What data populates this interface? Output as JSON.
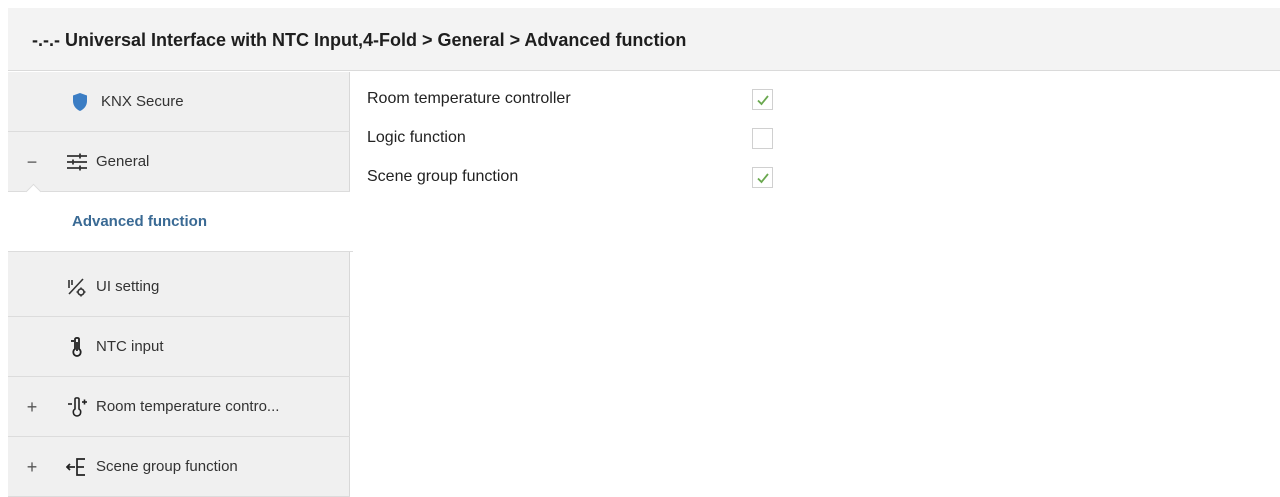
{
  "header": {
    "title": "-.-.- Universal Interface with NTC Input,4-Fold > General > Advanced function"
  },
  "sidebar": {
    "items": [
      {
        "label": "KNX Secure",
        "icon": "shield-icon",
        "expander": ""
      },
      {
        "label": "General",
        "icon": "sliders-icon",
        "expander": "−"
      },
      {
        "label": "Advanced function",
        "icon": "",
        "expander": ""
      },
      {
        "label": "UI setting",
        "icon": "ui-setting-icon",
        "expander": ""
      },
      {
        "label": "NTC input",
        "icon": "ntc-sensor-icon",
        "expander": ""
      },
      {
        "label": "Room temperature contro...",
        "icon": "thermometer-icon",
        "expander": "+"
      },
      {
        "label": "Scene group function",
        "icon": "scene-group-icon",
        "expander": "+"
      }
    ],
    "selected_index": 2,
    "selected_color": "#3a6a94"
  },
  "params": [
    {
      "label": "Room temperature controller",
      "checked": true
    },
    {
      "label": "Logic function",
      "checked": false
    },
    {
      "label": "Scene group function",
      "checked": true
    }
  ],
  "colors": {
    "check": "#6aa84f",
    "shield": "#3b7dc4"
  }
}
